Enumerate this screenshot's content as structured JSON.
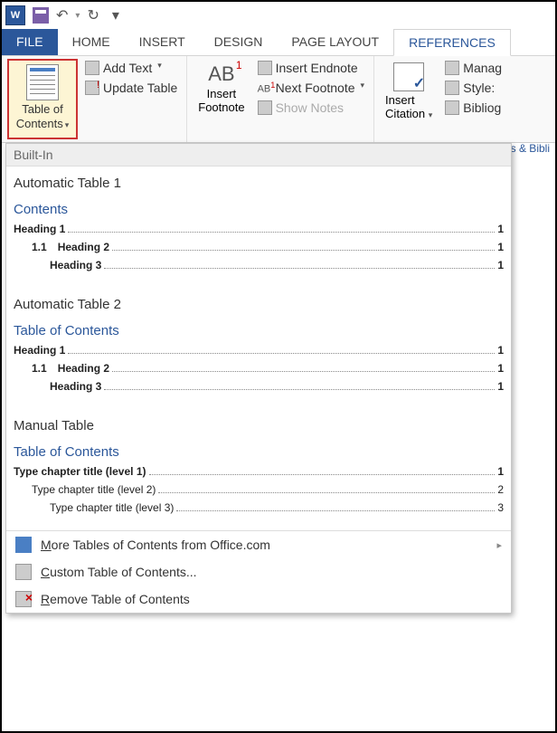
{
  "qat": {
    "app_letter": "W",
    "undo_glyph": "↶",
    "redo_glyph": "↻",
    "customize_glyph": "▾"
  },
  "tabs": {
    "file": "FILE",
    "home": "HOME",
    "insert": "INSERT",
    "design": "DESIGN",
    "page_layout": "PAGE LAYOUT",
    "references": "REFERENCES"
  },
  "ribbon": {
    "toc_button": "Table of\nContents",
    "add_text": "Add Text",
    "update_table": "Update Table",
    "insert_footnote": "Insert\nFootnote",
    "ab": "AB",
    "insert_endnote": "Insert Endnote",
    "next_footnote": "Next Footnote",
    "show_notes": "Show Notes",
    "insert_citation": "Insert\nCitation",
    "manage": "Manag",
    "style": "Style:",
    "biblio": "Bibliog",
    "group_label": "ions & Bibli"
  },
  "gallery": {
    "header": "Built-In",
    "auto1": {
      "title": "Automatic Table 1",
      "heading": "Contents",
      "lines": [
        {
          "level": 1,
          "num": "",
          "text": "Heading 1",
          "page": "1"
        },
        {
          "level": 2,
          "num": "1.1",
          "text": "Heading 2",
          "page": "1"
        },
        {
          "level": 3,
          "num": "",
          "text": "Heading 3",
          "page": "1"
        }
      ]
    },
    "auto2": {
      "title": "Automatic Table 2",
      "heading": "Table of Contents",
      "lines": [
        {
          "level": 1,
          "num": "",
          "text": "Heading 1",
          "page": "1"
        },
        {
          "level": 2,
          "num": "1.1",
          "text": "Heading 2",
          "page": "1"
        },
        {
          "level": 3,
          "num": "",
          "text": "Heading 3",
          "page": "1"
        }
      ]
    },
    "manual": {
      "title": "Manual Table",
      "heading": "Table of Contents",
      "lines": [
        {
          "level": 1,
          "num": "",
          "text": "Type chapter title (level 1)",
          "page": "1"
        },
        {
          "level": 2,
          "num": "",
          "text": "Type chapter title (level 2)",
          "page": "2"
        },
        {
          "level": 3,
          "num": "",
          "text": "Type chapter title (level 3)",
          "page": "3"
        }
      ]
    },
    "more": "More Tables of Contents from Office.com",
    "custom": "Custom Table of Contents...",
    "remove": "Remove Table of Contents"
  }
}
